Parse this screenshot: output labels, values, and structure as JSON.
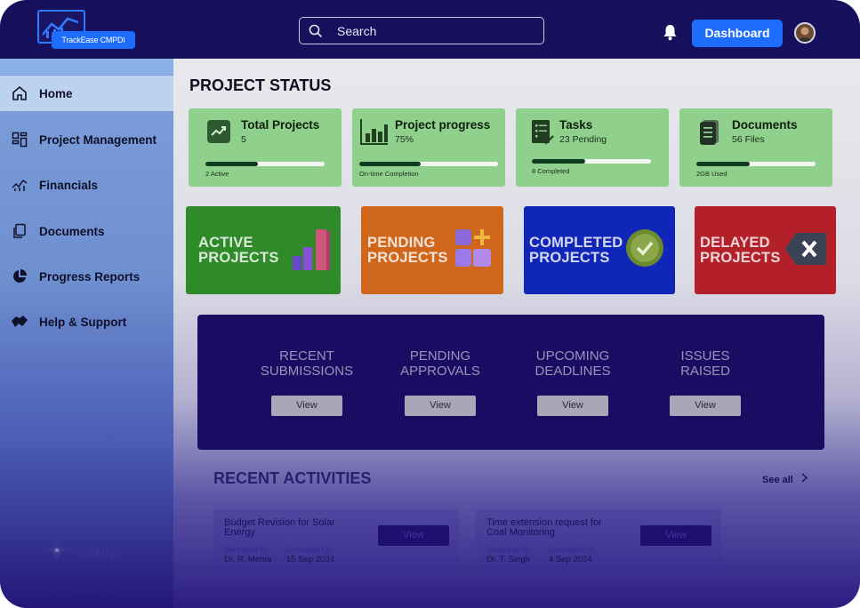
{
  "header": {
    "logo_text": "TrackEase CMPDI",
    "search_placeholder": "Search",
    "dashboard_button": "Dashboard"
  },
  "sidebar": {
    "items": [
      {
        "label": "Home",
        "icon": "home-icon",
        "active": true
      },
      {
        "label": "Project Management",
        "icon": "layout-icon",
        "active": false
      },
      {
        "label": "Financials",
        "icon": "financials-icon",
        "active": false
      },
      {
        "label": "Documents",
        "icon": "documents-icon",
        "active": false
      },
      {
        "label": "Progress Reports",
        "icon": "pie-chart-icon",
        "active": false
      },
      {
        "label": "Help & Support",
        "icon": "handshake-icon",
        "active": false
      }
    ],
    "settings_label": "Settings",
    "logout_label": "Log out"
  },
  "main": {
    "title": "PROJECT STATUS",
    "stats": [
      {
        "title": "Total Projects",
        "sub": "5",
        "progress": 0.44,
        "foot": "2 Active",
        "icon": "trend-icon"
      },
      {
        "title": "Project progress",
        "sub": "75%",
        "progress": 0.44,
        "foot": "On-time Completion",
        "icon": "bar-chart-icon"
      },
      {
        "title": "Tasks",
        "sub": "23 Pending",
        "progress": 0.45,
        "foot": "8 Completed",
        "icon": "checklist-icon"
      },
      {
        "title": "Documents",
        "sub": "56 Files",
        "progress": 0.45,
        "foot": "2GB Used",
        "icon": "document-stack-icon"
      }
    ],
    "categories": [
      {
        "line1": "ACTIVE",
        "line2": "PROJECTS",
        "color": "#2f8a2a"
      },
      {
        "line1": "PENDING",
        "line2": "PROJECTS",
        "color": "#d0661c"
      },
      {
        "line1": "COMPLETED",
        "line2": "PROJECTS",
        "color": "#0f26b8"
      },
      {
        "line1": "DELAYED",
        "line2": "PROJECTS",
        "color": "#b3202a"
      }
    ],
    "panel": [
      {
        "line1": "RECENT",
        "line2": "SUBMISSIONS",
        "button": "View"
      },
      {
        "line1": "PENDING",
        "line2": "APPROVALS",
        "button": "View"
      },
      {
        "line1": "UPCOMING",
        "line2": "DEADLINES",
        "button": "View"
      },
      {
        "line1": "ISSUES",
        "line2": "RAISED",
        "button": "View"
      }
    ],
    "recent": {
      "title": "RECENT ACTIVITIES",
      "see_all": "See all",
      "items": [
        {
          "title": "Budget Revision for Solar Energy",
          "by_label": "Generated By",
          "by": "Dr. R. Mehta",
          "on_label": "Generated On",
          "on": "15 Sep 2024",
          "button": "View"
        },
        {
          "title": "Time extension request for Coal Monitoring",
          "by_label": "Generated By",
          "by": "Dr. T. Singh",
          "on_label": "Generated On",
          "on": "4 Sep 2024",
          "button": "View"
        }
      ]
    }
  }
}
